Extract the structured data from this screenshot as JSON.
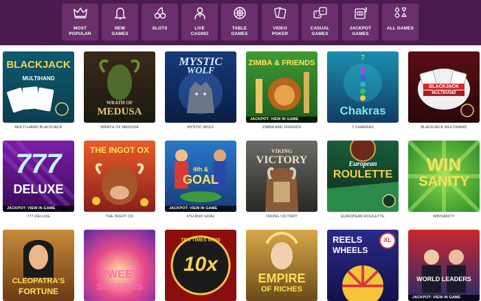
{
  "nav": {
    "categories": [
      {
        "label": "MOST\nPOPULAR",
        "icon": "crown-icon"
      },
      {
        "label": "NEW\nGAMES",
        "icon": "bell-icon"
      },
      {
        "label": "SLOTS",
        "icon": "cherries-icon"
      },
      {
        "label": "LIVE\nCASINO",
        "icon": "dealer-icon"
      },
      {
        "label": "TABLE\nGAMES",
        "icon": "roulette-icon"
      },
      {
        "label": "VIDEO\nPOKER",
        "icon": "cards-icon"
      },
      {
        "label": "CASUAL\nGAMES",
        "icon": "dice-icon"
      },
      {
        "label": "JACKPOT\nGAMES",
        "icon": "slot-machine-icon"
      },
      {
        "label": "ALL GAMES",
        "icon": "suits-icon"
      }
    ]
  },
  "games": [
    {
      "caption": "MULTI-HAND BLACKJACK",
      "art_title": "BLACKJACK",
      "art_sub": "MULTIHAND",
      "jackpot": ""
    },
    {
      "caption": "WRATH OF MEDUSA",
      "art_title": "MEDUSA",
      "art_sub": "WRATH OF",
      "jackpot": ""
    },
    {
      "caption": "MYSTIC WOLF",
      "art_title": "MYSTIC",
      "art_sub": "WOLF",
      "jackpot": ""
    },
    {
      "caption": "ZIMBA AND FRIENDS",
      "art_title": "ZIMBA & FRIENDS",
      "art_sub": "",
      "jackpot": "JACKPOT: VIEW IN GAME"
    },
    {
      "caption": "7 CHAKRAS",
      "art_title": "Chakras",
      "art_sub": "7",
      "jackpot": ""
    },
    {
      "caption": "BLACKJACK MULTIHAND",
      "art_title": "BLACKJACK",
      "art_sub": "MULTIHAND",
      "jackpot": ""
    },
    {
      "caption": "777 DELUXE",
      "art_title": "777",
      "art_sub": "DELUXE",
      "jackpot": "JACKPOT: VIEW IN GAME"
    },
    {
      "caption": "THE INGOT OX",
      "art_title": "THE INGOT OX",
      "art_sub": "",
      "jackpot": ""
    },
    {
      "caption": "4TH AND GOAL",
      "art_title": "GOAL",
      "art_sub": "4th &",
      "jackpot": "JACKPOT: VIEW IN GAME"
    },
    {
      "caption": "VIKING VICTORY",
      "art_title": "VICTORY",
      "art_sub": "VIKING",
      "jackpot": ""
    },
    {
      "caption": "EUROPEAN ROULETTE",
      "art_title": "ROULETTE",
      "art_sub": "European",
      "jackpot": ""
    },
    {
      "caption": "WINSANITY",
      "art_title": "WIN",
      "art_sub": "SANITY",
      "jackpot": ""
    },
    {
      "caption": "",
      "art_title": "CLEOPATRA'S",
      "art_sub": "FORTUNE",
      "jackpot": ""
    },
    {
      "caption": "",
      "art_title": "SWEET",
      "art_sub": "SUCCESS",
      "jackpot": ""
    },
    {
      "caption": "",
      "art_title": "10x",
      "art_sub": "TEN TIMES WINS",
      "jackpot": ""
    },
    {
      "caption": "",
      "art_title": "EMPIRE",
      "art_sub": "OF RICHES",
      "jackpot": ""
    },
    {
      "caption": "",
      "art_title": "REELS",
      "art_sub": "WHEELS",
      "art_badge": "XL",
      "jackpot": ""
    },
    {
      "caption": "",
      "art_title": "WORLD LEADERS",
      "art_sub": "",
      "jackpot": "JACKPOT: VIEW IN GAME"
    }
  ]
}
